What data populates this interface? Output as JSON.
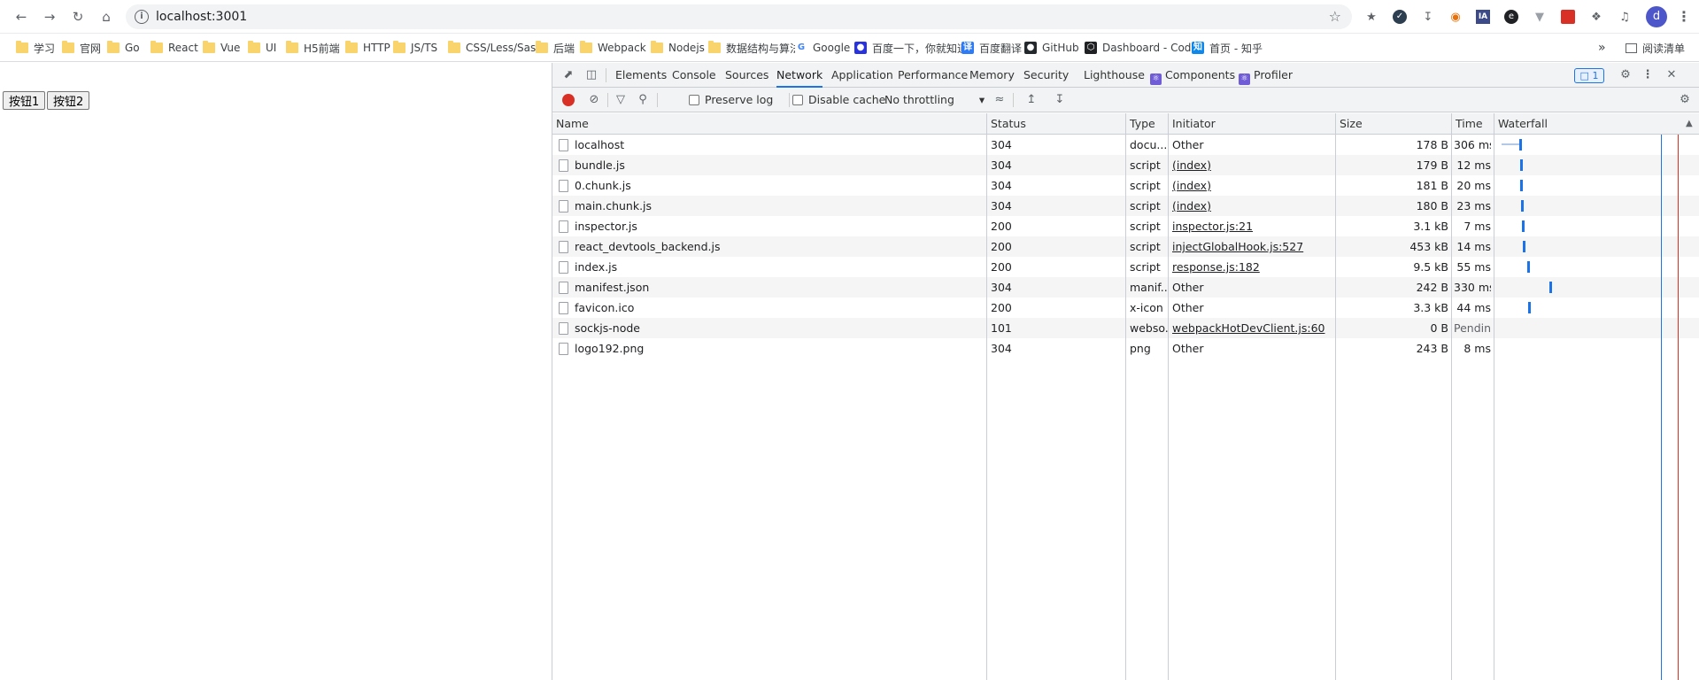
{
  "browser": {
    "url": "localhost:3001",
    "profile_initial": "d"
  },
  "bookmarks": [
    {
      "label": "学习",
      "icon": "folder-icon"
    },
    {
      "label": "官网",
      "icon": "folder-icon"
    },
    {
      "label": "Go",
      "icon": "folder-icon"
    },
    {
      "label": "React",
      "icon": "folder-icon"
    },
    {
      "label": "Vue",
      "icon": "folder-icon"
    },
    {
      "label": "UI",
      "icon": "folder-icon"
    },
    {
      "label": "H5前端",
      "icon": "folder-icon"
    },
    {
      "label": "HTTP",
      "icon": "folder-icon"
    },
    {
      "label": "JS/TS",
      "icon": "folder-icon"
    },
    {
      "label": "CSS/Less/Sass",
      "icon": "folder-icon"
    },
    {
      "label": "后端",
      "icon": "folder-icon"
    },
    {
      "label": "Webpack",
      "icon": "folder-icon"
    },
    {
      "label": "Nodejs",
      "icon": "folder-icon"
    },
    {
      "label": "数据结构与算法",
      "icon": "folder-icon"
    },
    {
      "label": "Google",
      "icon": "google-icon"
    },
    {
      "label": "百度一下，你就知道",
      "icon": "baidu-icon"
    },
    {
      "label": "百度翻译",
      "icon": "baidu-translate-icon"
    },
    {
      "label": "GitHub",
      "icon": "github-icon"
    },
    {
      "label": "Dashboard - Cod...",
      "icon": "codepen-icon"
    },
    {
      "label": "首页 - 知乎",
      "icon": "zhihu-icon"
    }
  ],
  "bookmarks_more": "»",
  "reading_list": "阅读清单",
  "page": {
    "button1": "按钮1",
    "button2": "按钮2"
  },
  "devtools": {
    "tabs": [
      "Elements",
      "Console",
      "Sources",
      "Network",
      "Application",
      "Performance",
      "Memory",
      "Security",
      "Lighthouse",
      "Components",
      "Profiler"
    ],
    "active_tab": "Network",
    "issues_count": "1",
    "toolbar": {
      "preserve_log": "Preserve log",
      "disable_cache": "Disable cache",
      "throttling": "No throttling"
    },
    "columns": [
      "Name",
      "Status",
      "Type",
      "Initiator",
      "Size",
      "Time",
      "Waterfall"
    ],
    "requests": [
      {
        "name": "localhost",
        "status": "304",
        "type": "docu...",
        "initiator": "Other",
        "initiator_link": false,
        "size": "178 B",
        "time": "306 ms"
      },
      {
        "name": "bundle.js",
        "status": "304",
        "type": "script",
        "initiator": "(index)",
        "initiator_link": true,
        "size": "179 B",
        "time": "12 ms"
      },
      {
        "name": "0.chunk.js",
        "status": "304",
        "type": "script",
        "initiator": "(index)",
        "initiator_link": true,
        "size": "181 B",
        "time": "20 ms"
      },
      {
        "name": "main.chunk.js",
        "status": "304",
        "type": "script",
        "initiator": "(index)",
        "initiator_link": true,
        "size": "180 B",
        "time": "23 ms"
      },
      {
        "name": "inspector.js",
        "status": "200",
        "type": "script",
        "initiator": "inspector.js:21",
        "initiator_link": true,
        "size": "3.1 kB",
        "time": "7 ms"
      },
      {
        "name": "react_devtools_backend.js",
        "status": "200",
        "type": "script",
        "initiator": "injectGlobalHook.js:527",
        "initiator_link": true,
        "size": "453 kB",
        "time": "14 ms"
      },
      {
        "name": "index.js",
        "status": "200",
        "type": "script",
        "initiator": "response.js:182",
        "initiator_link": true,
        "size": "9.5 kB",
        "time": "55 ms"
      },
      {
        "name": "manifest.json",
        "status": "304",
        "type": "manif...",
        "initiator": "Other",
        "initiator_link": false,
        "size": "242 B",
        "time": "330 ms"
      },
      {
        "name": "favicon.ico",
        "status": "200",
        "type": "x-icon",
        "initiator": "Other",
        "initiator_link": false,
        "size": "3.3 kB",
        "time": "44 ms"
      },
      {
        "name": "sockjs-node",
        "status": "101",
        "type": "webso...",
        "initiator": "webpackHotDevClient.js:60",
        "initiator_link": true,
        "size": "0 B",
        "time": "Pending"
      },
      {
        "name": "logo192.png",
        "status": "304",
        "type": "png",
        "initiator": "Other",
        "initiator_link": false,
        "size": "243 B",
        "time": "8 ms"
      }
    ]
  },
  "colors": {
    "accent": "#1a73e8",
    "record": "#d93025",
    "react": "#6f5cd6"
  }
}
